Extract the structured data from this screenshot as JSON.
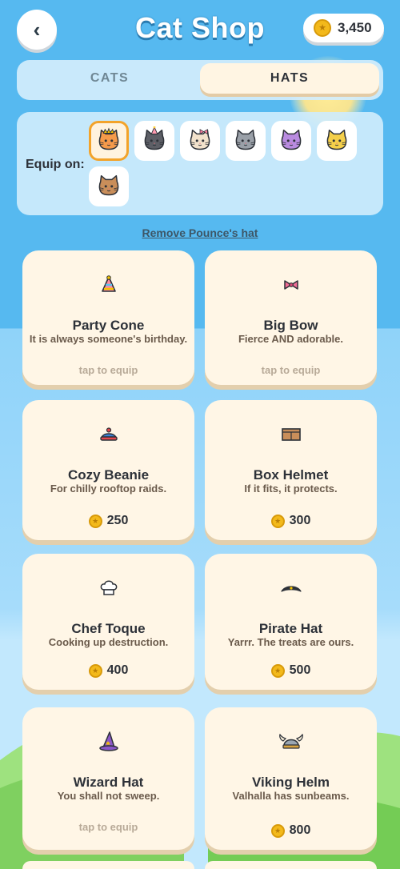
{
  "header": {
    "back_icon": "chevron-left-icon",
    "back_glyph": "‹",
    "title": "Cat Shop",
    "coins": "3,450"
  },
  "tabs": [
    {
      "label": "CATS",
      "active": false
    },
    {
      "label": "HATS",
      "active": true
    }
  ],
  "equip_panel": {
    "label": "Equip on:",
    "cats": [
      {
        "name": "orange-cat",
        "color": "#f59a4a",
        "hat": "crown",
        "selected": true
      },
      {
        "name": "dark-gray-cat",
        "color": "#5d5f66",
        "hat": "party-cone",
        "selected": false
      },
      {
        "name": "cream-cat",
        "color": "#f2e2cc",
        "hat": "bow",
        "selected": false
      },
      {
        "name": "gray-cat",
        "color": "#9aa0a8",
        "hat": "none",
        "selected": false
      },
      {
        "name": "purple-cat",
        "color": "#b98be0",
        "hat": "none",
        "selected": false
      },
      {
        "name": "yellow-cat",
        "color": "#f4cf4a",
        "hat": "none",
        "selected": false
      },
      {
        "name": "brown-cat",
        "color": "#c98e5a",
        "hat": "none",
        "selected": false
      }
    ]
  },
  "remove_hat_label": "Remove Pounce's hat",
  "hats": [
    {
      "name": "Party Cone",
      "desc": "It is always someone's birthday.",
      "icon": "party-cone-icon",
      "owned": true,
      "action": "tap to equip"
    },
    {
      "name": "Big Bow",
      "desc": "Fierce AND adorable.",
      "icon": "bow-icon",
      "owned": true,
      "action": "tap to equip"
    },
    {
      "name": "Cozy Beanie",
      "desc": "For chilly rooftop raids.",
      "icon": "beanie-icon",
      "owned": false,
      "price": "250"
    },
    {
      "name": "Box Helmet",
      "desc": "If it fits, it protects.",
      "icon": "box-helmet-icon",
      "owned": false,
      "price": "300"
    },
    {
      "name": "Chef Toque",
      "desc": "Cooking up destruction.",
      "icon": "chef-toque-icon",
      "owned": false,
      "price": "400"
    },
    {
      "name": "Pirate Hat",
      "desc": "Yarrr. The treats are ours.",
      "icon": "pirate-hat-icon",
      "owned": false,
      "price": "500"
    },
    {
      "name": "Wizard Hat",
      "desc": "You shall not sweep.",
      "icon": "wizard-hat-icon",
      "owned": true,
      "action": "tap to equip"
    },
    {
      "name": "Viking Helm",
      "desc": "Valhalla has sunbeams.",
      "icon": "viking-helm-icon",
      "owned": false,
      "price": "800"
    }
  ],
  "colors": {
    "sky": "#56b9f0",
    "card": "#fff6e6",
    "coin": "#f3b91b",
    "selected_border": "#f3a32a",
    "hill": "#8fd86f"
  }
}
